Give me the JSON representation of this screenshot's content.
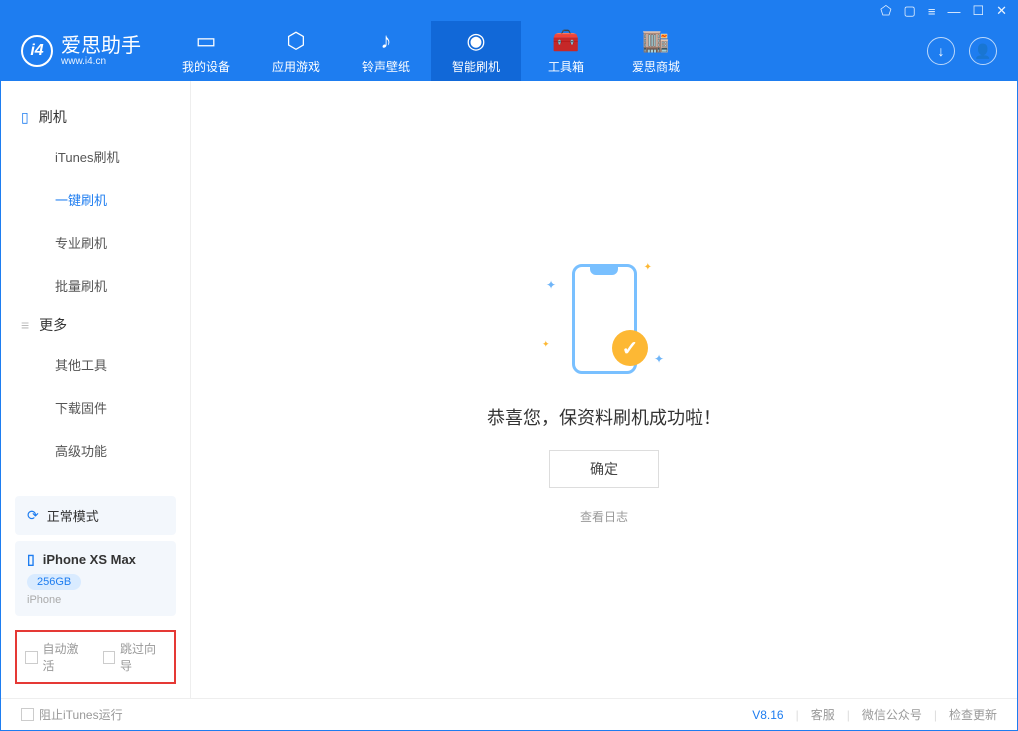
{
  "app": {
    "name": "爱思助手",
    "url": "www.i4.cn"
  },
  "titlebar_icons": [
    "shirt-icon",
    "cube-icon",
    "menu-icon",
    "minimize-icon",
    "maximize-icon",
    "close-icon"
  ],
  "tabs": [
    {
      "label": "我的设备",
      "icon": "device-icon"
    },
    {
      "label": "应用游戏",
      "icon": "apps-icon"
    },
    {
      "label": "铃声壁纸",
      "icon": "music-icon"
    },
    {
      "label": "智能刷机",
      "icon": "flash-icon",
      "active": true
    },
    {
      "label": "工具箱",
      "icon": "toolbox-icon"
    },
    {
      "label": "爱思商城",
      "icon": "store-icon"
    }
  ],
  "sidebar": {
    "section1": {
      "title": "刷机",
      "items": [
        "iTunes刷机",
        "一键刷机",
        "专业刷机",
        "批量刷机"
      ],
      "activeIndex": 1
    },
    "section2": {
      "title": "更多",
      "items": [
        "其他工具",
        "下载固件",
        "高级功能"
      ]
    },
    "status": "正常模式",
    "device": {
      "name": "iPhone XS Max",
      "storage": "256GB",
      "type": "iPhone"
    },
    "checks": {
      "auto_activate": "自动激活",
      "skip_guide": "跳过向导"
    }
  },
  "main": {
    "success_msg": "恭喜您，保资料刷机成功啦！",
    "ok_btn": "确定",
    "log_link": "查看日志"
  },
  "footer": {
    "block_itunes": "阻止iTunes运行",
    "version": "V8.16",
    "links": [
      "客服",
      "微信公众号",
      "检查更新"
    ]
  }
}
